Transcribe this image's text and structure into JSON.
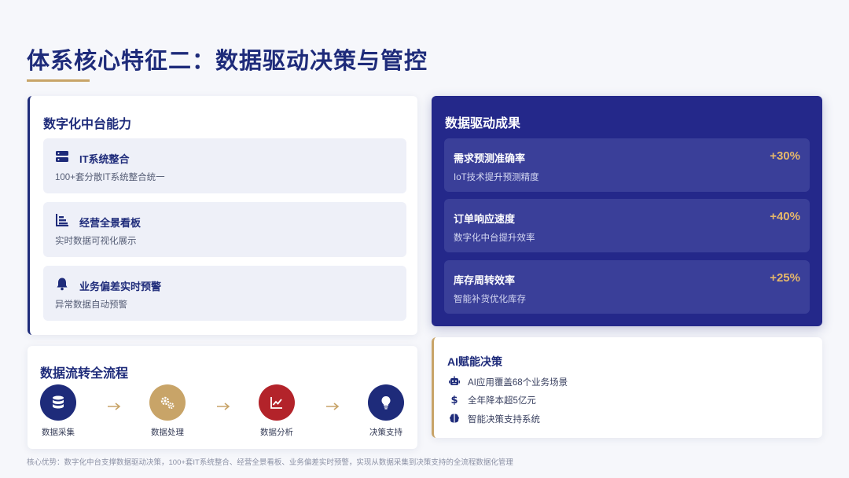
{
  "title": "体系核心特征二：数据驱动决策与管控",
  "colors": {
    "navy": "#1e2b7a",
    "gold": "#c8a468",
    "red": "#b3232a",
    "results_bg": "#24288a",
    "results_accent": "#e6b86a"
  },
  "capability": {
    "heading": "数字化中台能力",
    "items": [
      {
        "icon": "server-icon",
        "title": "IT系统整合",
        "desc": "100+套分散IT系统整合统一"
      },
      {
        "icon": "bar-chart-icon",
        "title": "经营全景看板",
        "desc": "实时数据可视化展示"
      },
      {
        "icon": "bell-icon",
        "title": "业务偏差实时预警",
        "desc": "异常数据自动预警"
      }
    ]
  },
  "flow": {
    "heading": "数据流转全流程",
    "steps": [
      {
        "icon": "database-icon",
        "label": "数据采集",
        "color": "#1e2b7a"
      },
      {
        "icon": "cogs-icon",
        "label": "数据处理",
        "color": "#c8a468"
      },
      {
        "icon": "line-chart-icon",
        "label": "数据分析",
        "color": "#b3232a"
      },
      {
        "icon": "lightbulb-icon",
        "label": "决策支持",
        "color": "#1e2b7a"
      }
    ]
  },
  "results": {
    "heading": "数据驱动成果",
    "items": [
      {
        "title": "需求预测准确率",
        "desc": "IoT技术提升预测精度",
        "value": "+30%"
      },
      {
        "title": "订单响应速度",
        "desc": "数字化中台提升效率",
        "value": "+40%"
      },
      {
        "title": "库存周转效率",
        "desc": "智能补货优化库存",
        "value": "+25%"
      }
    ]
  },
  "ai": {
    "heading": "AI赋能决策",
    "items": [
      {
        "icon": "robot-icon",
        "text": "AI应用覆盖68个业务场景"
      },
      {
        "icon": "dollar-icon",
        "text": "全年降本超5亿元"
      },
      {
        "icon": "brain-icon",
        "text": "智能决策支持系统"
      }
    ]
  },
  "footnote": "核心优势：数字化中台支撑数据驱动决策，100+套IT系统整合、经营全景看板、业务偏差实时预警，实现从数据采集到决策支持的全流程数据化管理"
}
